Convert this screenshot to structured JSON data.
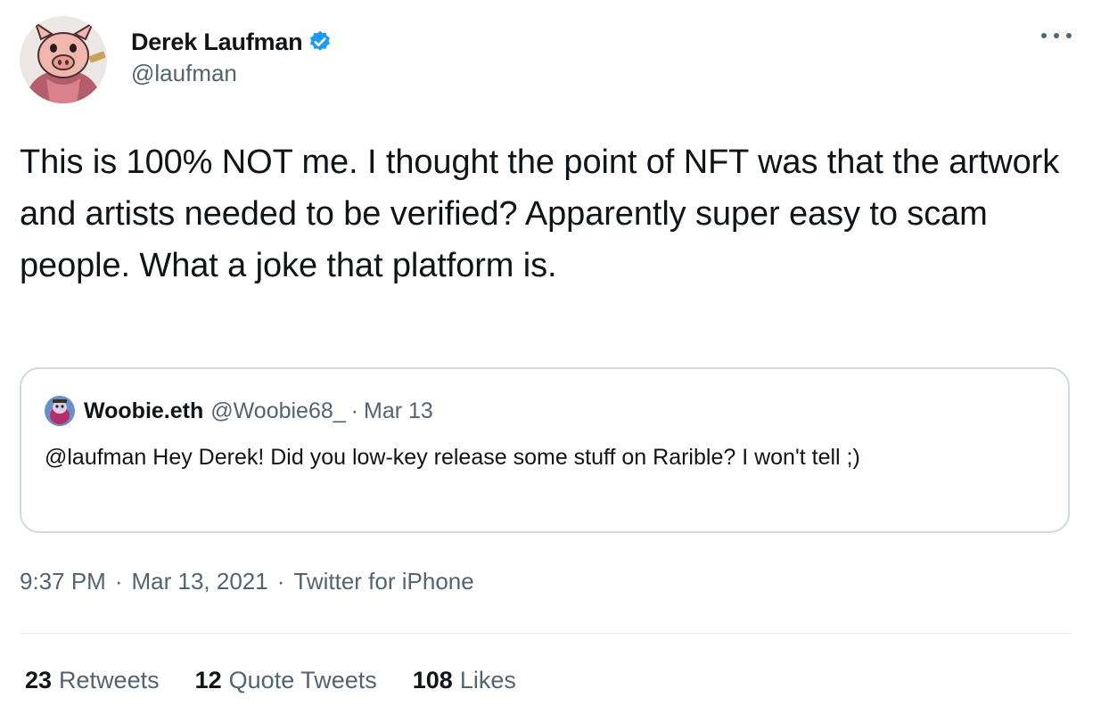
{
  "tweet": {
    "author": {
      "display_name": "Derek Laufman",
      "handle": "@laufman",
      "verified": true,
      "avatar_icon": "pig-character-avatar"
    },
    "text": "This is 100% NOT me. I thought the point of NFT was that the artwork and artists needed to be verified? Apparently super easy to scam people. What a joke that platform is.",
    "quoted_tweet": {
      "display_name": "Woobie.eth",
      "handle": "@Woobie68_",
      "separator": "·",
      "date": "Mar 13",
      "text": "@laufman Hey Derek! Did you low-key release some stuff on Rarible? I won't tell ;)"
    },
    "meta": {
      "time": "9:37 PM",
      "separator": "·",
      "date": "Mar 13, 2021",
      "source": "Twitter for iPhone"
    },
    "stats": [
      {
        "count": "23",
        "label": "Retweets"
      },
      {
        "count": "12",
        "label": "Quote Tweets"
      },
      {
        "count": "108",
        "label": "Likes"
      }
    ]
  },
  "colors": {
    "text_primary": "#0f1419",
    "text_secondary": "#536471",
    "verified_blue": "#1d9bf0",
    "border": "#cfd9de"
  }
}
